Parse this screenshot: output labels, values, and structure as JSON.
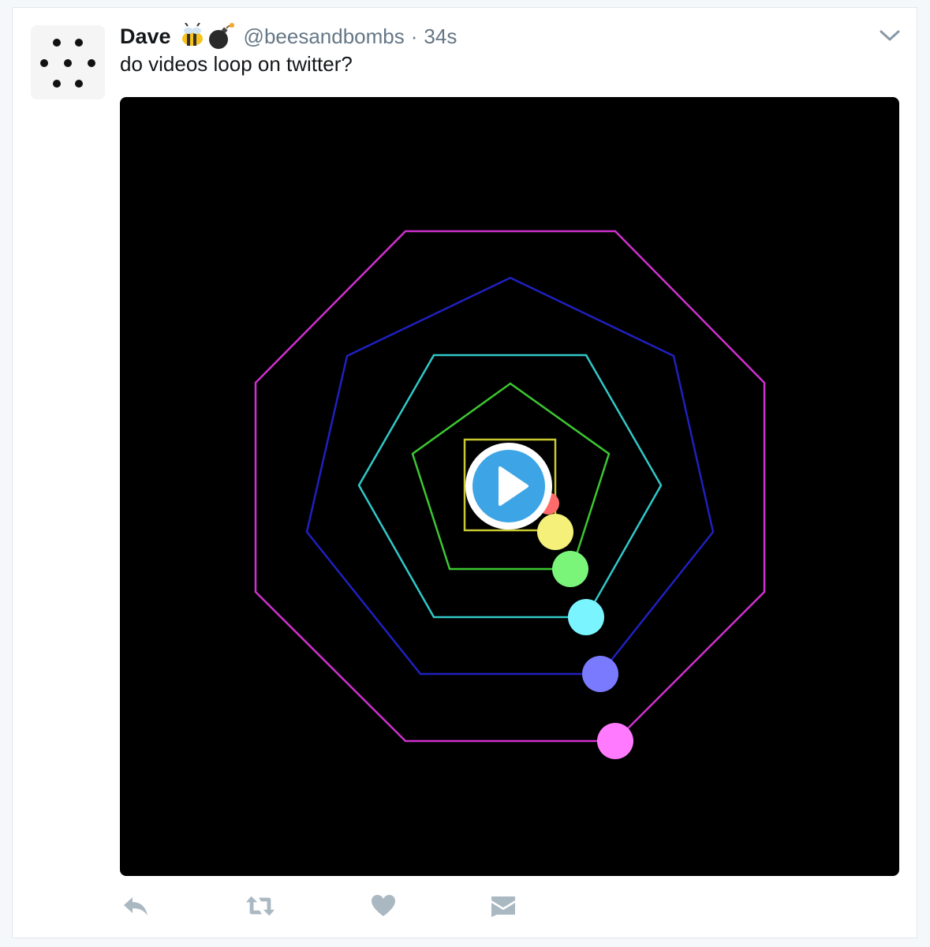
{
  "tweet": {
    "author_name": "Dave",
    "author_emoji": "bee-and-bomb-emoji",
    "handle": "@beesandbombs",
    "separator": "·",
    "timestamp": "34s",
    "text": "do videos loop on twitter?"
  },
  "icons": {
    "caret": "chevron-down-icon",
    "play": "play-icon",
    "reply": "reply-icon",
    "retweet": "retweet-icon",
    "like": "heart-icon",
    "message": "direct-message-icon"
  },
  "colors": {
    "text": "#14171a",
    "secondary_text": "#657786",
    "action_icon": "#aab8c2",
    "play_button": "#1b95e0",
    "shapes": {
      "triangle": "#3a5fd0",
      "square": "#c8c832",
      "pentagon": "#3cc832",
      "hexagon": "#32c8c8",
      "heptagon": "#2020c0",
      "octagon": "#d030d0"
    },
    "dots": [
      "#ff6b6b",
      "#f5f07a",
      "#7af57a",
      "#7af5ff",
      "#7a7aff",
      "#ff7aff"
    ]
  }
}
